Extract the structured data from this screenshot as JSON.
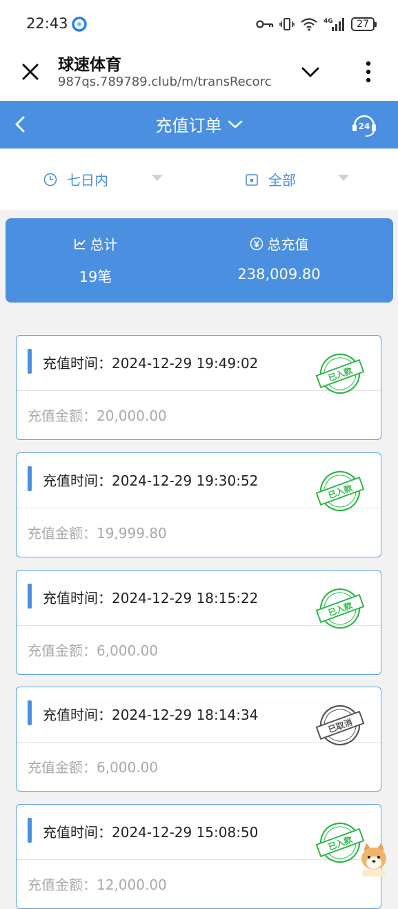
{
  "status_bar": {
    "time": "22:43",
    "battery": "27",
    "network": "4G"
  },
  "browser": {
    "title": "球速体育",
    "url": "987qs.789789.club/m/transRecorc"
  },
  "nav": {
    "title": "充值订单",
    "support_badge": "24"
  },
  "filters": {
    "date": "七日内",
    "type": "全部"
  },
  "summary": {
    "total_label": "总计",
    "total_value": "19笔",
    "amount_label": "总充值",
    "amount_value": "238,009.80"
  },
  "colors": {
    "accent": "#4a8fe0",
    "stamp_green": "#2eb84a",
    "stamp_gray": "#555555"
  },
  "records": [
    {
      "time_label": "充值时间：2024-12-29 19:49:02",
      "amount_label": "充值金额：20,000.00",
      "status": "已入款",
      "status_color": "#2eb84a"
    },
    {
      "time_label": "充值时间：2024-12-29 19:30:52",
      "amount_label": "充值金额：19,999.80",
      "status": "已入款",
      "status_color": "#2eb84a"
    },
    {
      "time_label": "充值时间：2024-12-29 18:15:22",
      "amount_label": "充值金额：6,000.00",
      "status": "已入款",
      "status_color": "#2eb84a"
    },
    {
      "time_label": "充值时间：2024-12-29 18:14:34",
      "amount_label": "充值金额：6,000.00",
      "status": "已取消",
      "status_color": "#555555"
    },
    {
      "time_label": "充值时间：2024-12-29 15:08:50",
      "amount_label": "充值金额：12,000.00",
      "status": "已入款",
      "status_color": "#2eb84a"
    }
  ]
}
